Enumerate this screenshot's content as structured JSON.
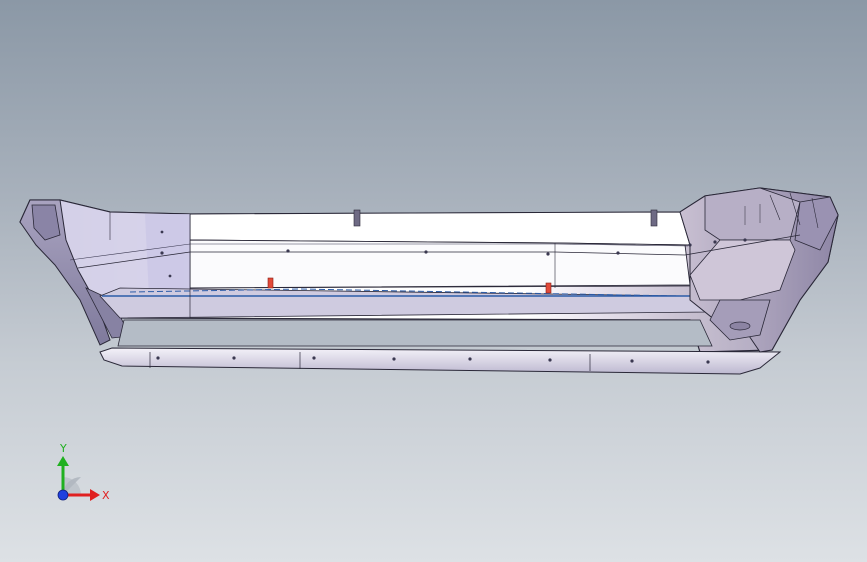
{
  "viewport": {
    "background_top": "#8b98a6",
    "background_bottom": "#dde1e5"
  },
  "model": {
    "part": "bumper-assembly",
    "body_color": "#ece9f4",
    "edge_color": "#2a2838",
    "highlight_color": "#ffffff",
    "blue_edge_color": "#2c5ca8",
    "red_marker_color": "#e14a3a"
  },
  "triad": {
    "x_label": "X",
    "y_label": "Y",
    "x_color": "#e02020",
    "y_color": "#20b020",
    "z_color": "#2040e0"
  }
}
